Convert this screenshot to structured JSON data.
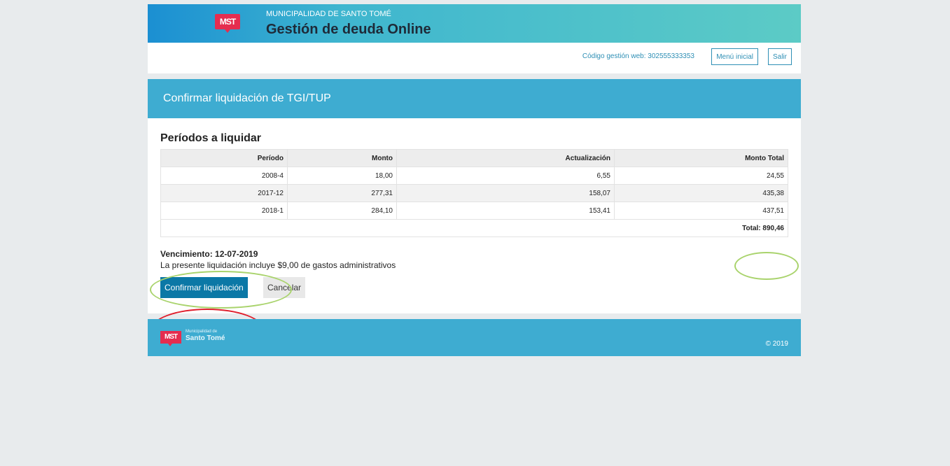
{
  "header": {
    "logo_text": "MST",
    "subtitle": "MUNICIPALIDAD DE SANTO TOMÉ",
    "title": "Gestión de deuda Online"
  },
  "userbar": {
    "codigo": "Código gestión web: 302555333353",
    "menu_label": "Menú inicial",
    "salir_label": "Salir"
  },
  "panel": {
    "title": "Confirmar liquidación de TGI/TUP",
    "section_title": "Períodos a liquidar",
    "columns": [
      "Período",
      "Monto",
      "Actualización",
      "Monto Total"
    ],
    "rows": [
      [
        "2008-4",
        "18,00",
        "6,55",
        "24,55"
      ],
      [
        "2017-12",
        "277,31",
        "158,07",
        "435,38"
      ],
      [
        "2018-1",
        "284,10",
        "153,41",
        "437,51"
      ]
    ],
    "total": "Total: 890,46",
    "vencimiento": "Vencimiento: 12-07-2019",
    "nota": "La presente liquidación incluye $9,00 de gastos administrativos",
    "confirm_label": "Confirmar liquidación",
    "cancel_label": "Cancelar"
  },
  "footer": {
    "logo_text": "MST",
    "sub": "Municipalidad de",
    "name": "Santo Tomé",
    "copyright": "© 2019"
  },
  "colors": {
    "header_gradient_start": "#1b8fd2",
    "header_gradient_end": "#5ccbc6",
    "panel_head": "#3eacd1",
    "primary_button": "#0b78a6",
    "brand_red": "#e52d4f",
    "annotation_green": "#a9d36c",
    "annotation_red": "#e0202e"
  }
}
